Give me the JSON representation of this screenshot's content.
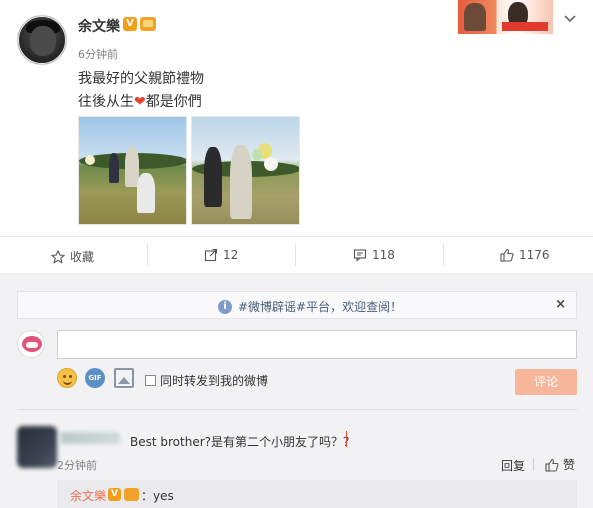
{
  "post": {
    "username": "余文樂",
    "verified_badge": "V",
    "time": "6分钟前",
    "text_line1": "我最好的父親節禮物",
    "text_line2_a": "往後从生",
    "text_line2_heart": "❤",
    "text_line2_b": "都是你們"
  },
  "actions": {
    "favorite_label": "收藏",
    "share_count": "12",
    "comment_count": "118",
    "like_count": "1176"
  },
  "notice": {
    "text": "#微博辟谣#平台，欢迎查阅！",
    "info_glyph": "i",
    "close_glyph": "×"
  },
  "composer": {
    "gif_label": "GIF",
    "repost_checkbox_label": "同时转发到我的微博",
    "submit_label": "评论"
  },
  "comment": {
    "text": "Best brother?是有第二个小朋友了吗？？",
    "time": "2分钟前",
    "reply_label": "回复",
    "like_label": "赞"
  },
  "sub_reply": {
    "name": "余文樂",
    "verified_badge": "V",
    "text": "：yes"
  },
  "colors": {
    "accent_orange": "#eb7350",
    "submit_disabled": "#f7b59a",
    "notice_text": "#4a5c7a",
    "background_comments": "#f2f2f5"
  }
}
